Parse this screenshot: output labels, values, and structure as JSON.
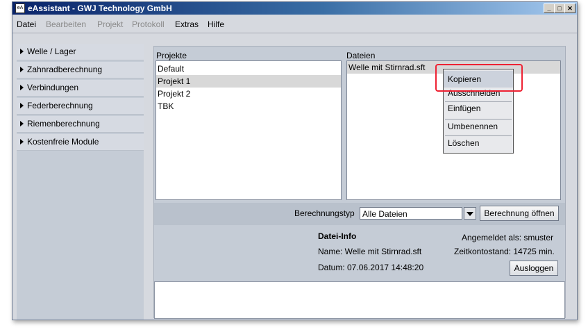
{
  "window": {
    "title": "eAssistant - GWJ Technology GmbH",
    "icon_label": "eA"
  },
  "window_controls": {
    "minimize": "_",
    "maximize": "□",
    "close": "✕"
  },
  "menu": {
    "items": [
      {
        "label": "Datei",
        "enabled": true
      },
      {
        "label": "Bearbeiten",
        "enabled": false
      },
      {
        "label": "Projekt",
        "enabled": false
      },
      {
        "label": "Protokoll",
        "enabled": false
      },
      {
        "label": "Extras",
        "enabled": true
      },
      {
        "label": "Hilfe",
        "enabled": true
      }
    ]
  },
  "sidebar": {
    "items": [
      {
        "label": "Welle / Lager"
      },
      {
        "label": "Zahnradberechnung"
      },
      {
        "label": "Verbindungen"
      },
      {
        "label": "Federberechnung"
      },
      {
        "label": "Riemenberechnung"
      },
      {
        "label": "Kostenfreie Module"
      }
    ]
  },
  "projects": {
    "header": "Projekte",
    "items": [
      "Default",
      "Projekt 1",
      "Projekt 2",
      "TBK"
    ],
    "selected_index": 1
  },
  "files": {
    "header": "Dateien",
    "items": [
      "Welle mit Stirnrad.sft"
    ],
    "selected_index": 0
  },
  "context_menu": {
    "items": [
      "Kopieren",
      "Ausschneiden",
      "Einfügen",
      "Umbenennen",
      "Löschen"
    ],
    "highlighted_index": 0
  },
  "calc_bar": {
    "type_label": "Berechnungstyp",
    "type_value": "Alle Dateien",
    "open_button": "Berechnung öffnen"
  },
  "file_info": {
    "title": "Datei-Info",
    "name_line": "Name: Welle mit Stirnrad.sft",
    "date_line": "Datum: 07.06.2017 14:48:20",
    "logged_in": "Angemeldet als: smuster",
    "time_account": "Zeitkontostand: 14725 min.",
    "logout_button": "Ausloggen"
  },
  "colors": {
    "highlight_annotation": "#ee2233",
    "titlebar": "#0a246a"
  }
}
